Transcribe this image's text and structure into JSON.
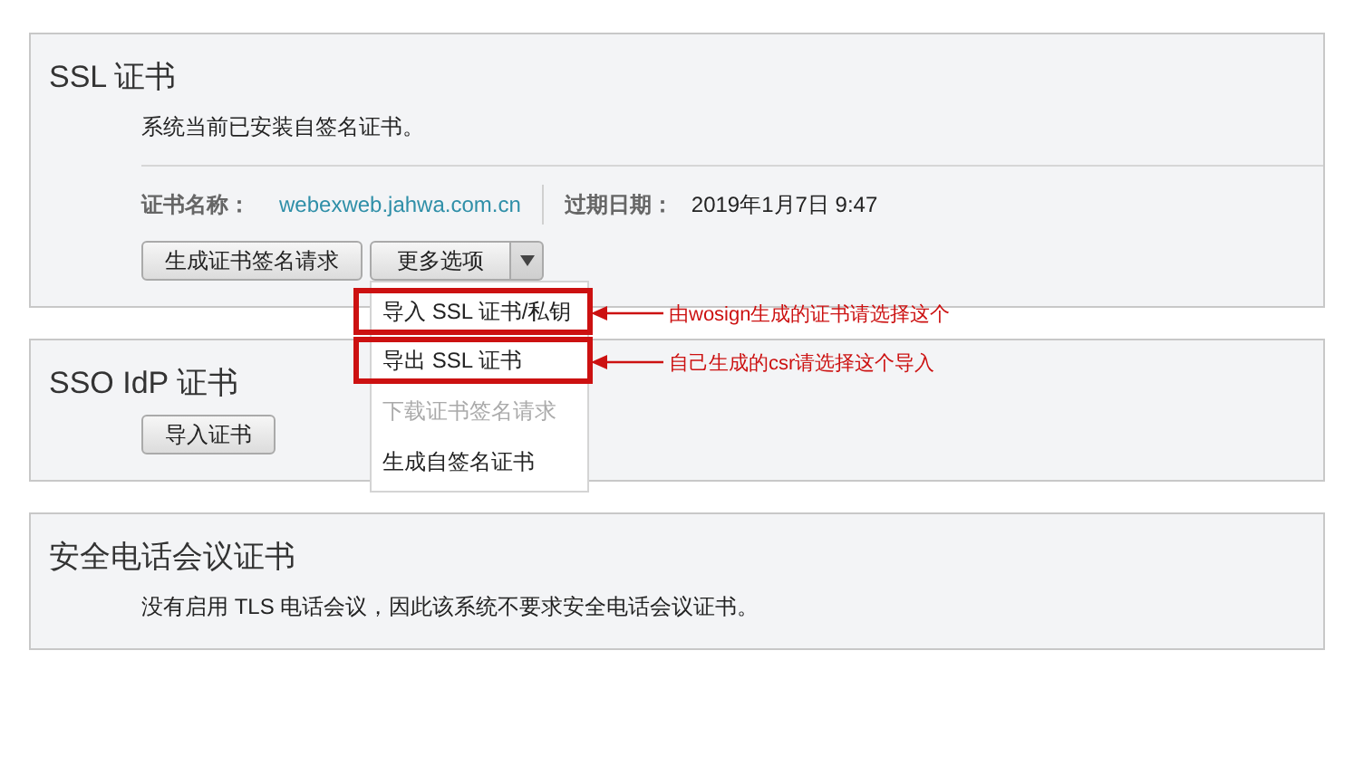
{
  "sections": [
    {
      "title": "SSL 证书",
      "description": "系统当前已安装自签名证书。",
      "certificate": {
        "name_label": "证书名称：",
        "name": "webexweb.jahwa.com.cn",
        "expiry_label": "过期日期：",
        "expiry": "2019年1月7日 9:47"
      },
      "buttons": [
        {
          "label": "生成证书签名请求",
          "kind": "plain"
        },
        {
          "label": "更多选项",
          "kind": "split",
          "expanded": true
        }
      ]
    },
    {
      "title": "SSO IdP 证书",
      "buttons": [
        {
          "label": "导入证书",
          "kind": "plain"
        }
      ]
    },
    {
      "title": "安全电话会议证书",
      "description": "没有启用 TLS 电话会议，因此该系统不要求安全电话会议证书。"
    }
  ],
  "more_options_menu": {
    "items": [
      {
        "label": "导入 SSL 证书/私钥",
        "disabled": false,
        "annotation": "由wosign生成的证书请选择这个"
      },
      {
        "label": "导出 SSL 证书",
        "disabled": false,
        "annotation": "自己生成的csr请选择这个导入"
      },
      {
        "label": "下载证书签名请求",
        "disabled": true
      },
      {
        "label": "生成自签名证书",
        "disabled": false
      }
    ]
  }
}
